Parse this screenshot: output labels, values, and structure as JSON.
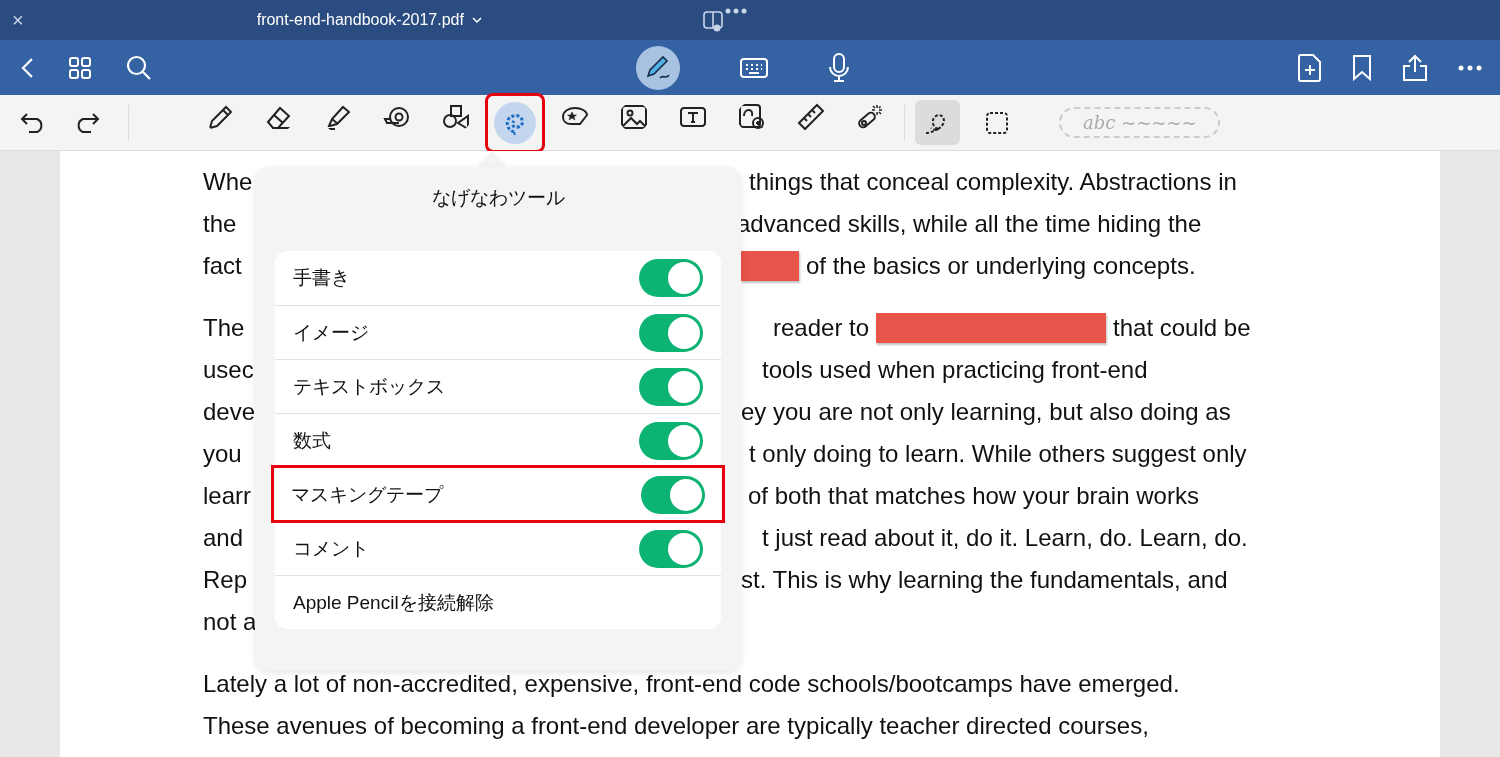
{
  "title_bar": {
    "close": "×",
    "title": "front-end-handbook-2017.pdf"
  },
  "tools": [
    {
      "kind": "pen",
      "selected": false,
      "highlighted": false
    },
    {
      "kind": "eraser",
      "selected": false,
      "highlighted": false
    },
    {
      "kind": "highlighter",
      "selected": false,
      "highlighted": false
    },
    {
      "kind": "tape",
      "selected": false,
      "highlighted": false
    },
    {
      "kind": "shapes",
      "selected": false,
      "highlighted": false
    },
    {
      "kind": "lasso",
      "selected": true,
      "highlighted": true
    },
    {
      "kind": "sticker",
      "selected": false,
      "highlighted": false
    },
    {
      "kind": "image",
      "selected": false,
      "highlighted": false
    },
    {
      "kind": "textbox",
      "selected": false,
      "highlighted": false
    },
    {
      "kind": "image-zoom",
      "selected": false,
      "highlighted": false
    },
    {
      "kind": "ruler",
      "selected": false,
      "highlighted": false
    },
    {
      "kind": "laser",
      "selected": false,
      "highlighted": false
    }
  ],
  "select_tools": [
    {
      "kind": "freeform",
      "selected": true
    },
    {
      "kind": "rectangle",
      "selected": false
    }
  ],
  "handwriting_hint": "abc ~~~~~",
  "document": [
    {
      "lines": [
        {
          "left": "Whe",
          "segments": [
            {
              "kind": "text",
              "text": "things that conceal complexity. Abstractions in"
            }
          ]
        },
        {
          "left": "the",
          "segments": [
            {
              "kind": "text",
              "text": "advanced skills, while all the time hiding the"
            }
          ]
        },
        {
          "left": "fact",
          "segments": [
            {
              "kind": "tape"
            },
            {
              "kind": "text",
              "text": "of the basics or underlying concepts."
            }
          ]
        }
      ]
    },
    {
      "lines": [
        {
          "left": "The",
          "segments": [
            {
              "kind": "text",
              "text": "reader to"
            },
            {
              "kind": "tape"
            },
            {
              "kind": "text",
              "text": "that could be"
            }
          ]
        },
        {
          "left": "usec",
          "segments": [
            {
              "kind": "text",
              "text": "tools used when practicing front-end"
            }
          ]
        },
        {
          "left": "deve",
          "segments": [
            {
              "kind": "text",
              "text": "ey you are not only learning, but also doing as"
            }
          ]
        },
        {
          "left": "you",
          "segments": [
            {
              "kind": "text",
              "text": "t only doing to learn. While others suggest only"
            }
          ]
        },
        {
          "left": "learr",
          "segments": [
            {
              "kind": "text",
              "text": "of both that matches how your brain works"
            }
          ]
        },
        {
          "left": "and",
          "segments": [
            {
              "kind": "text",
              "text": "t just read about it, do it. Learn, do. Learn, do."
            }
          ]
        },
        {
          "left": "Rep",
          "segments": [
            {
              "kind": "text",
              "text": "st. This is why learning the fundamentals, and"
            }
          ]
        },
        {
          "left": "not a"
        }
      ]
    },
    {
      "lines": [
        {
          "left": "Lately a lot of non-accredited, expensive, front-end code schools/bootcamps have emerged."
        },
        {
          "left": "These avenues of becoming a front-end developer are typically teacher directed courses,"
        }
      ]
    }
  ],
  "popover": {
    "title": "なげなわツール",
    "rows": [
      {
        "kind": "toggle",
        "label": "手書き",
        "on": true,
        "highlighted": false
      },
      {
        "kind": "toggle",
        "label": "イメージ",
        "on": true,
        "highlighted": false
      },
      {
        "kind": "toggle",
        "label": "テキストボックス",
        "on": true,
        "highlighted": false
      },
      {
        "kind": "toggle",
        "label": "数式",
        "on": true,
        "highlighted": false
      },
      {
        "kind": "toggle",
        "label": "マスキングテープ",
        "on": true,
        "highlighted": true
      },
      {
        "kind": "toggle",
        "label": "コメント",
        "on": true,
        "highlighted": false
      },
      {
        "kind": "action",
        "label": "Apple Pencilを接続解除",
        "highlighted": false
      }
    ]
  }
}
